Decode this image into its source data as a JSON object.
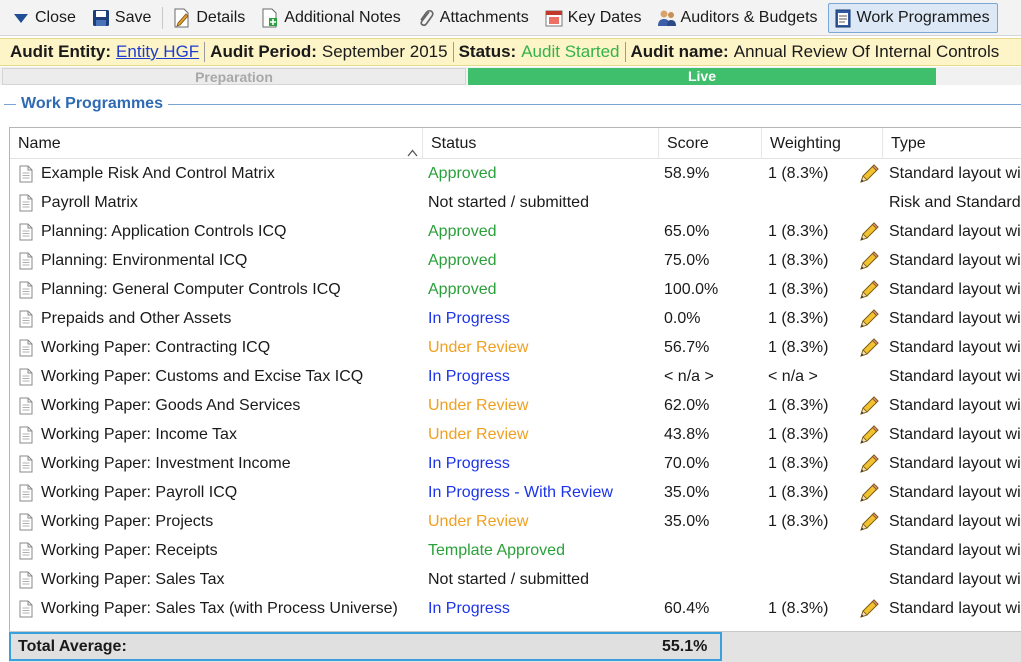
{
  "toolbar": {
    "close": "Close",
    "save": "Save",
    "details": "Details",
    "additional_notes": "Additional Notes",
    "attachments": "Attachments",
    "key_dates": "Key Dates",
    "auditors_budgets": "Auditors & Budgets",
    "work_programmes": "Work Programmes"
  },
  "info": {
    "entity_key": "Audit Entity:",
    "entity_val": "Entity HGF",
    "period_key": "Audit Period:",
    "period_val": "September 2015",
    "status_key": "Status:",
    "status_val": "Audit Started",
    "name_key": "Audit name:",
    "name_val": "Annual Review Of Internal Controls"
  },
  "stages": {
    "preparation": "Preparation",
    "live": "Live"
  },
  "group_title": "Work Programmes",
  "columns": {
    "name": "Name",
    "status": "Status",
    "score": "Score",
    "weighting": "Weighting",
    "type": "Type"
  },
  "rows": [
    {
      "name": "Example Risk And Control Matrix",
      "status": "Approved",
      "score": "58.9%",
      "weighting": "1  (8.3%)",
      "type": "Standard layout wi",
      "edit": true,
      "status_kind": "approved"
    },
    {
      "name": "Payroll Matrix",
      "status": "Not started / submitted",
      "score": "",
      "weighting": "",
      "type": "Risk and Standard l",
      "edit": false,
      "status_kind": "none"
    },
    {
      "name": "Planning: Application Controls ICQ",
      "status": "Approved",
      "score": "65.0%",
      "weighting": "1  (8.3%)",
      "type": "Standard layout wi",
      "edit": true,
      "status_kind": "approved"
    },
    {
      "name": "Planning: Environmental ICQ",
      "status": "Approved",
      "score": "75.0%",
      "weighting": "1  (8.3%)",
      "type": "Standard layout wi",
      "edit": true,
      "status_kind": "approved"
    },
    {
      "name": "Planning: General Computer Controls ICQ",
      "status": "Approved",
      "score": "100.0%",
      "weighting": "1  (8.3%)",
      "type": "Standard layout wi",
      "edit": true,
      "status_kind": "approved"
    },
    {
      "name": "Prepaids and Other Assets",
      "status": "In Progress",
      "score": "0.0%",
      "weighting": "1  (8.3%)",
      "type": "Standard layout wi",
      "edit": true,
      "status_kind": "progress"
    },
    {
      "name": "Working Paper: Contracting ICQ",
      "status": "Under Review",
      "score": "56.7%",
      "weighting": "1  (8.3%)",
      "type": "Standard layout wi",
      "edit": true,
      "status_kind": "review"
    },
    {
      "name": "Working Paper: Customs and Excise Tax ICQ",
      "status": "In Progress",
      "score": "< n/a >",
      "weighting": "< n/a >",
      "type": "Standard layout wi",
      "edit": false,
      "status_kind": "progress"
    },
    {
      "name": "Working Paper: Goods And Services",
      "status": "Under Review",
      "score": "62.0%",
      "weighting": "1  (8.3%)",
      "type": "Standard layout wi",
      "edit": true,
      "status_kind": "review"
    },
    {
      "name": "Working Paper: Income Tax",
      "status": "Under Review",
      "score": "43.8%",
      "weighting": "1  (8.3%)",
      "type": "Standard layout wi",
      "edit": true,
      "status_kind": "review"
    },
    {
      "name": "Working Paper: Investment Income",
      "status": "In Progress",
      "score": "70.0%",
      "weighting": "1  (8.3%)",
      "type": "Standard layout wi",
      "edit": true,
      "status_kind": "progress"
    },
    {
      "name": "Working Paper: Payroll ICQ",
      "status": "In Progress - With Review",
      "score": "35.0%",
      "weighting": "1  (8.3%)",
      "type": "Standard layout wi",
      "edit": true,
      "status_kind": "progress"
    },
    {
      "name": "Working Paper: Projects",
      "status": "Under Review",
      "score": "35.0%",
      "weighting": "1  (8.3%)",
      "type": "Standard layout wi",
      "edit": true,
      "status_kind": "review"
    },
    {
      "name": "Working Paper: Receipts",
      "status": "Template Approved",
      "score": "",
      "weighting": "",
      "type": "Standard layout wi",
      "edit": false,
      "status_kind": "approved"
    },
    {
      "name": "Working Paper: Sales Tax",
      "status": "Not started / submitted",
      "score": "",
      "weighting": "",
      "type": "Standard layout wi",
      "edit": false,
      "status_kind": "none"
    },
    {
      "name": "Working Paper: Sales Tax (with Process Universe)",
      "status": "In Progress",
      "score": "60.4%",
      "weighting": "1  (8.3%)",
      "type": "Standard layout wi",
      "edit": true,
      "status_kind": "progress"
    }
  ],
  "footer": {
    "label": "Total Average:",
    "value": "55.1%"
  }
}
